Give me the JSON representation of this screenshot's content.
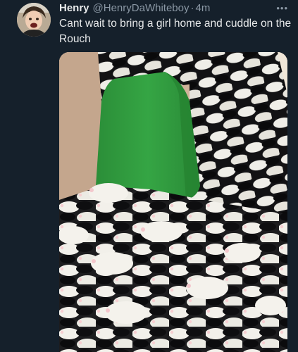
{
  "tweet": {
    "author_name": "Henry",
    "handle": "@HenryDaWhiteboy",
    "separator": "·",
    "time": "4m",
    "more_icon": "more-horizontal-icon",
    "text": "Cant wait to bring a girl home and cuddle on the Rouch"
  },
  "colors": {
    "background": "#15202b",
    "primary_text": "#e7e9ea",
    "secondary_text": "#8b98a5",
    "couch_green": "#2f9a3e"
  }
}
